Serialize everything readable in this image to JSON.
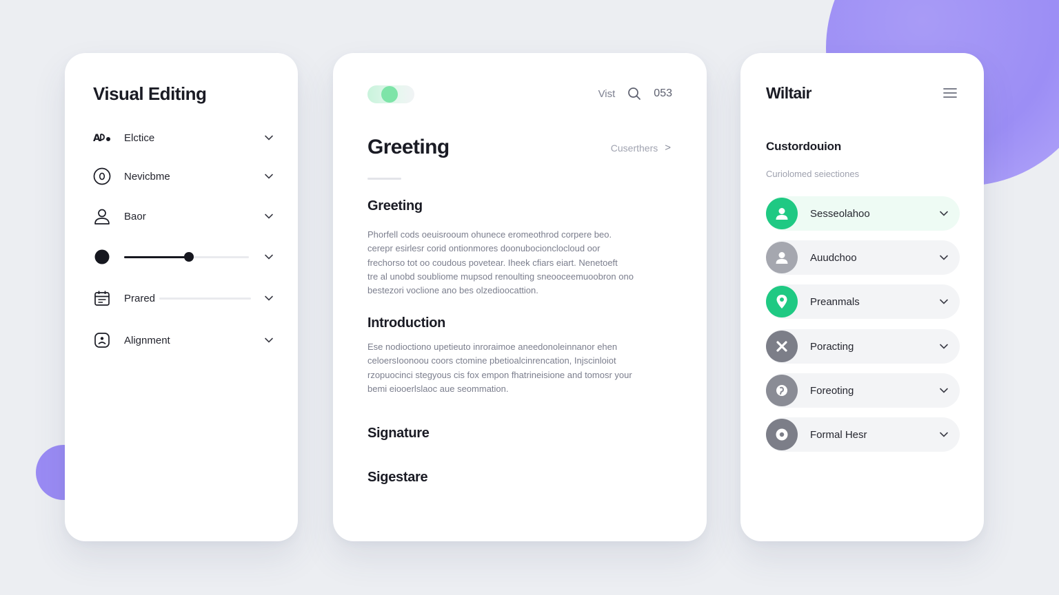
{
  "colors": {
    "accent_green": "#1fc983",
    "accent_purple": "#9c8ef5",
    "avatar_gray": "#8e9099",
    "dark": "#16171f"
  },
  "left_panel": {
    "title": "Visual Editing",
    "items": [
      {
        "label": "Elctice",
        "icon": "font-style-icon"
      },
      {
        "label": "Nevicbme",
        "icon": "circle-o-icon"
      },
      {
        "label": "Baor",
        "icon": "user-icon"
      },
      {
        "label": "",
        "icon": "dot-icon",
        "slider_value": 0.52
      },
      {
        "label": "Prared",
        "icon": "calendar-icon"
      },
      {
        "label": "Alignment",
        "icon": "face-icon"
      }
    ]
  },
  "middle_panel": {
    "top_link": "Vist",
    "count": "053",
    "title": "Greeting",
    "breadcrumb": "Cuserthers",
    "breadcrumb_arrow": ">",
    "sections": [
      {
        "heading": "Greeting",
        "lines": [
          "Phorfell cods oeuisrooum ohunece eromeothrod corpere beo.",
          "cerepr esirlesr corid ontionmores doonubocionclocloud oor",
          "frechorso tot oo coudous povetear. Iheek cfiars eiart. Nenetoeft",
          "tre al unobd soubliome mupsod renoulting sneooceemuoobron ono",
          "bestezori voclione ano bes olzedioocattion."
        ]
      },
      {
        "heading": "Introduction",
        "lines": [
          "Ese nodioctiono upetieuto inroraimoe aneedonoleinnanor ehen",
          "celoersIoonoou coors ctomine pbetioalcinrencation, Injscinloiot",
          "rzopuocinci stegyous cis fox empon fhatrineisione and tomosr your",
          "bemi eiooerlslaoc aue seommation."
        ]
      },
      {
        "heading": "Signature",
        "lines": []
      },
      {
        "heading": "Sigestare",
        "lines": []
      }
    ]
  },
  "right_panel": {
    "title": "Wiltair",
    "subtitle": "Custordouion",
    "description": "Curiolomed seiectiones",
    "items": [
      {
        "label": "Sesseolahoo",
        "icon": "user-icon",
        "color": "#1fc983",
        "active": true
      },
      {
        "label": "Auudchoo",
        "icon": "user-icon",
        "color": "#a5a7af",
        "active": false
      },
      {
        "label": "Preanmals",
        "icon": "location-pin-icon",
        "color": "#1fc983",
        "active": false
      },
      {
        "label": "Poracting",
        "icon": "close-icon",
        "color": "#7c7e88",
        "active": false
      },
      {
        "label": "Foreoting",
        "icon": "pin-icon",
        "color": "#8a8c95",
        "active": false
      },
      {
        "label": "Formal Hesr",
        "icon": "record-icon",
        "color": "#7c7e88",
        "active": false
      }
    ]
  }
}
